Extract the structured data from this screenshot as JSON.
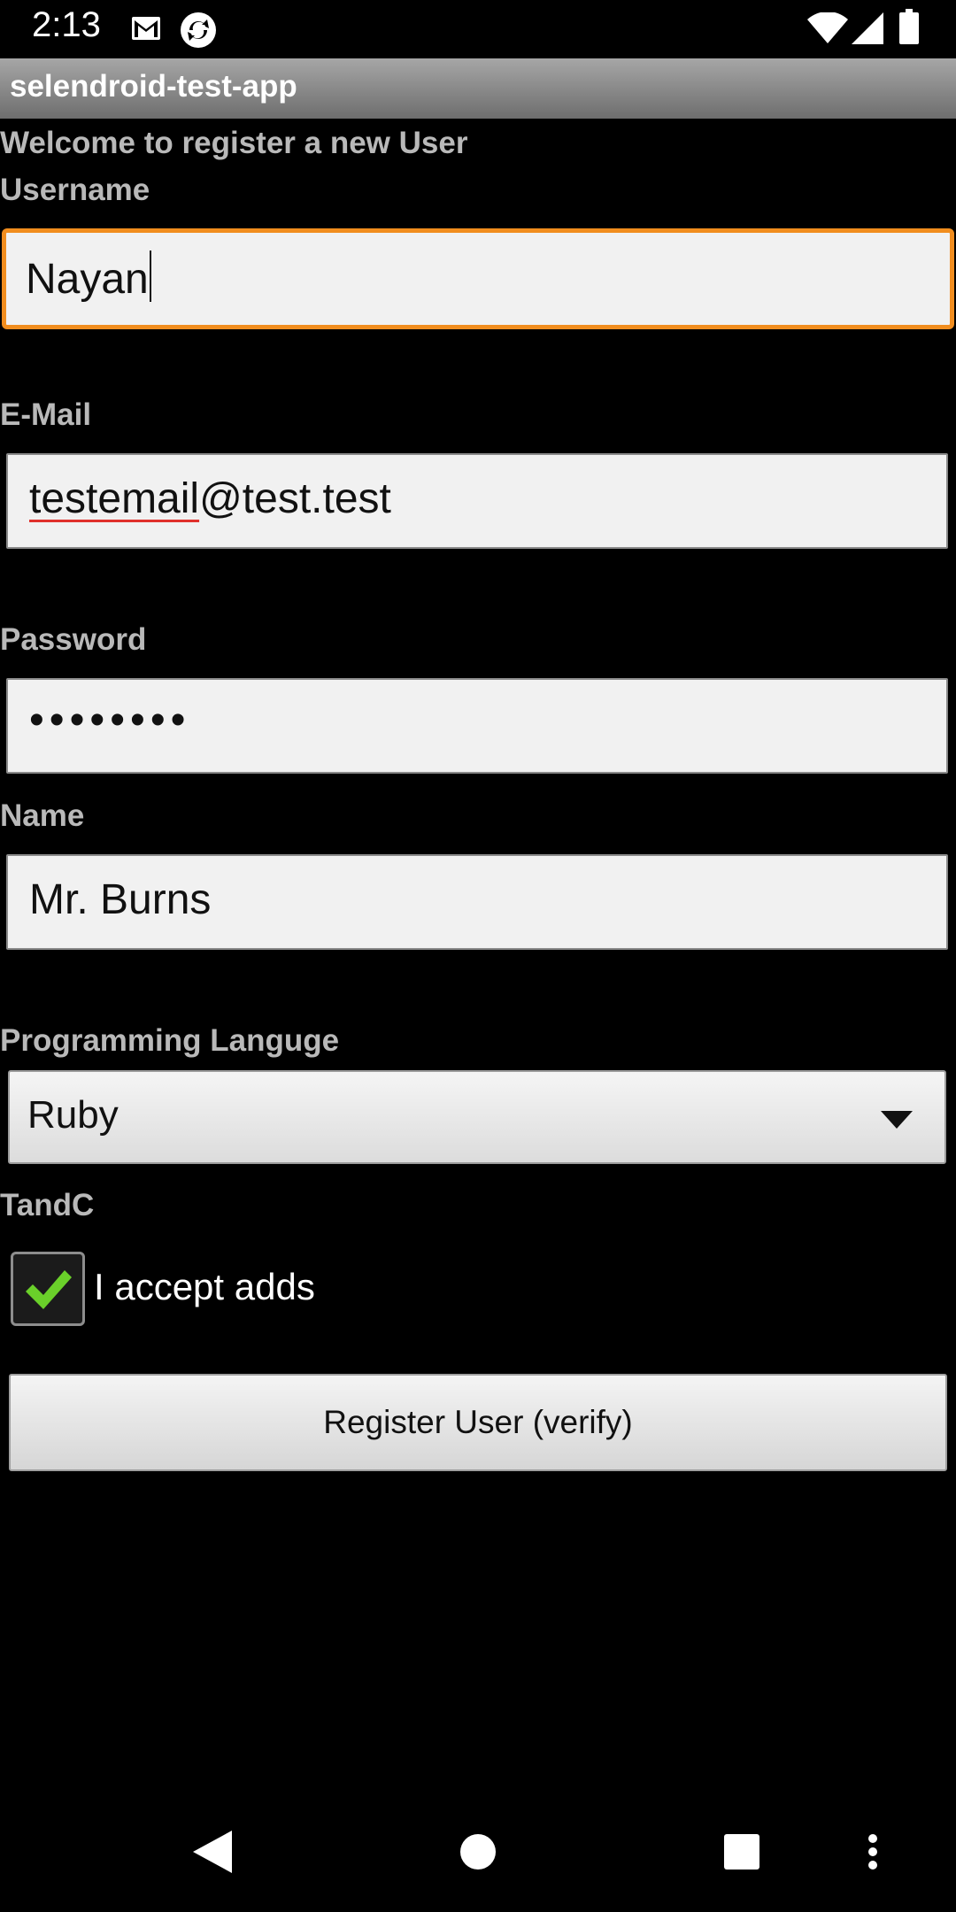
{
  "status_bar": {
    "time": "2:13",
    "icons": [
      "gmail-icon",
      "sync-icon",
      "wifi-icon",
      "signal-icon",
      "battery-icon"
    ]
  },
  "app": {
    "title": "selendroid-test-app"
  },
  "form": {
    "welcome": "Welcome to register a new User",
    "username": {
      "label": "Username",
      "value": "Nayan"
    },
    "email": {
      "label": "E-Mail",
      "value_underlined": "testemail",
      "value_rest": "@test.test"
    },
    "password": {
      "label": "Password",
      "value": "••••••••"
    },
    "name": {
      "label": "Name",
      "value": "Mr. Burns"
    },
    "language": {
      "label": "Programming Languge",
      "value": "Ruby"
    },
    "tandc": {
      "label": "TandC",
      "checkbox_label": "I accept adds",
      "checked": true
    },
    "register_button": "Register User (verify)"
  },
  "colors": {
    "focus_border": "#f18d1e",
    "check": "#6ad02a",
    "spell_underline": "#e0312c"
  },
  "nav_bar": {
    "icons": [
      "back-icon",
      "home-icon",
      "recents-icon",
      "overflow-menu-icon"
    ]
  }
}
